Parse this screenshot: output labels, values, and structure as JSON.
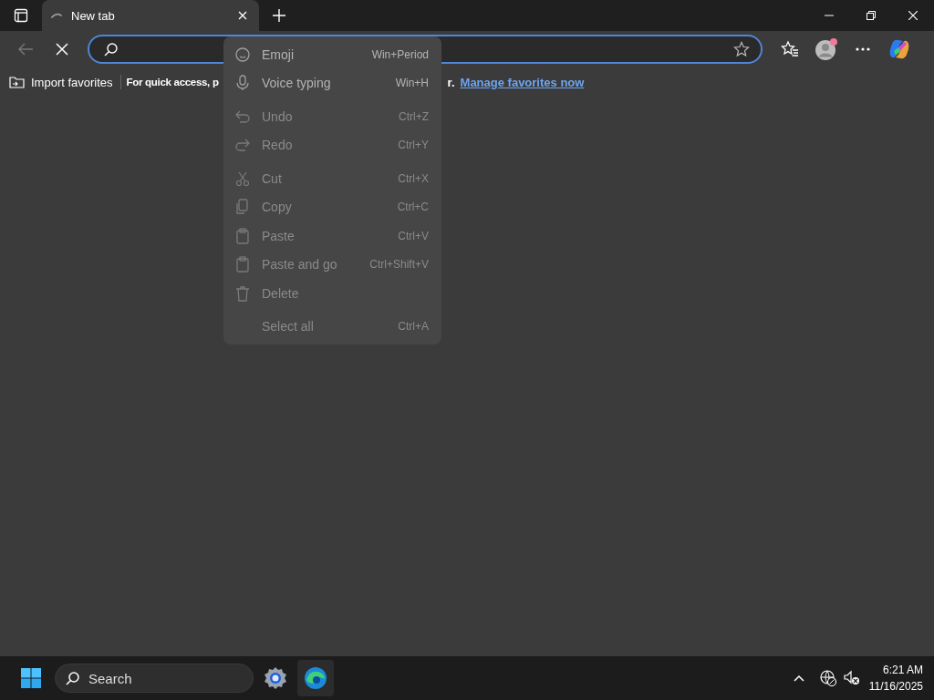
{
  "tabs": [
    {
      "title": "New tab",
      "selected": true,
      "loading": true
    }
  ],
  "address_bar": {
    "focused": true
  },
  "favorites_bar": {
    "import_label": "Import favorites",
    "hint_start": "For quick access, p",
    "hint_end": "r.",
    "link": "Manage favorites now"
  },
  "context_menu": {
    "items": [
      {
        "kind": "item",
        "label": "Emoji",
        "shortcut": "Win+Period",
        "disabled": false
      },
      {
        "kind": "item",
        "label": "Voice typing",
        "shortcut": "Win+H",
        "disabled": false
      },
      {
        "kind": "separator"
      },
      {
        "kind": "item",
        "label": "Undo",
        "shortcut": "Ctrl+Z",
        "disabled": true
      },
      {
        "kind": "item",
        "label": "Redo",
        "shortcut": "Ctrl+Y",
        "disabled": true
      },
      {
        "kind": "separator"
      },
      {
        "kind": "item",
        "label": "Cut",
        "shortcut": "Ctrl+X",
        "disabled": true
      },
      {
        "kind": "item",
        "label": "Copy",
        "shortcut": "Ctrl+C",
        "disabled": true
      },
      {
        "kind": "item",
        "label": "Paste",
        "shortcut": "Ctrl+V",
        "disabled": true
      },
      {
        "kind": "item",
        "label": "Paste and go",
        "shortcut": "Ctrl+Shift+V",
        "disabled": true
      },
      {
        "kind": "item",
        "label": "Delete",
        "disabled": true
      },
      {
        "kind": "separator"
      },
      {
        "kind": "item",
        "label": "Select all",
        "shortcut": "Ctrl+A",
        "disabled": true
      }
    ]
  },
  "taskbar": {
    "search_placeholder": "Search",
    "time": "6:21 AM",
    "date": "11/16/2025"
  }
}
